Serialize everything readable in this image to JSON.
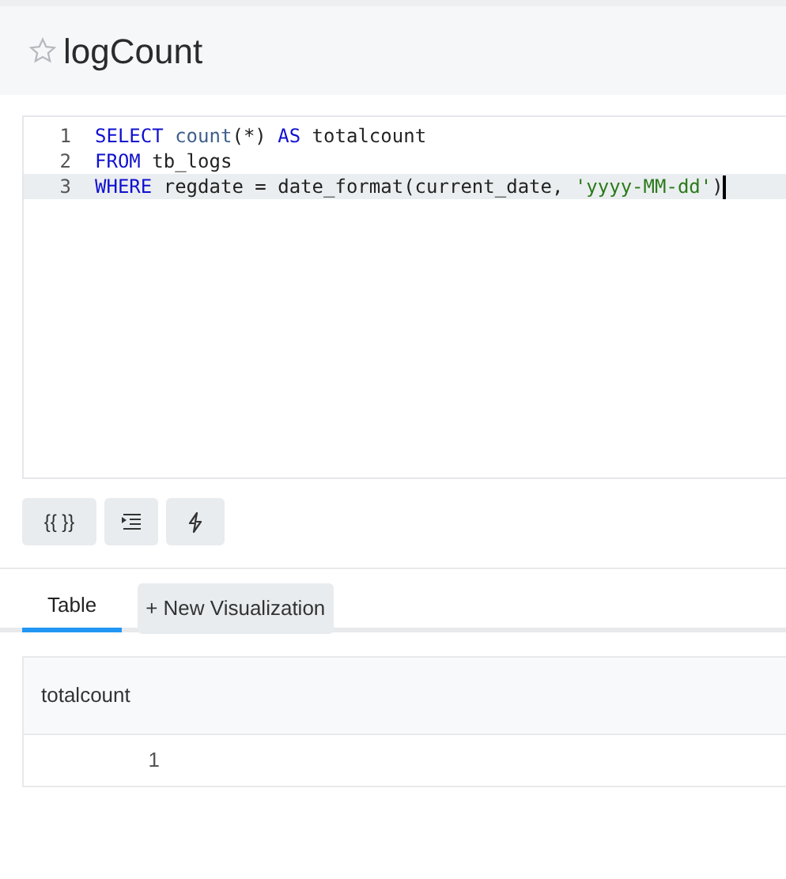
{
  "query": {
    "title": "logCount",
    "favorite": false
  },
  "editor": {
    "lines": [
      {
        "number": "1",
        "active": false,
        "tokens": [
          {
            "kind": "keyword",
            "text": "SELECT"
          },
          {
            "kind": "function",
            "text": " count"
          },
          {
            "kind": "plain",
            "text": "(*) "
          },
          {
            "kind": "keyword",
            "text": "AS"
          },
          {
            "kind": "plain",
            "text": " totalcount"
          }
        ]
      },
      {
        "number": "2",
        "active": false,
        "tokens": [
          {
            "kind": "keyword",
            "text": "FROM"
          },
          {
            "kind": "plain",
            "text": " tb_logs"
          }
        ]
      },
      {
        "number": "3",
        "active": true,
        "tokens": [
          {
            "kind": "keyword",
            "text": "WHERE"
          },
          {
            "kind": "plain",
            "text": " regdate = date_format(current_date, "
          },
          {
            "kind": "string",
            "text": "'yyyy-MM-dd'"
          },
          {
            "kind": "plain",
            "text": ")"
          }
        ]
      }
    ]
  },
  "toolbar": [
    {
      "kind": "braces",
      "label": "{{ }}"
    },
    {
      "kind": "indent"
    },
    {
      "kind": "bolt"
    }
  ],
  "tabs": [
    {
      "label": "Table",
      "selected": true
    }
  ],
  "new_visualization": "+ New Visualization",
  "table": {
    "columns": [
      "totalcount"
    ],
    "rows": [
      [
        "1"
      ]
    ]
  }
}
